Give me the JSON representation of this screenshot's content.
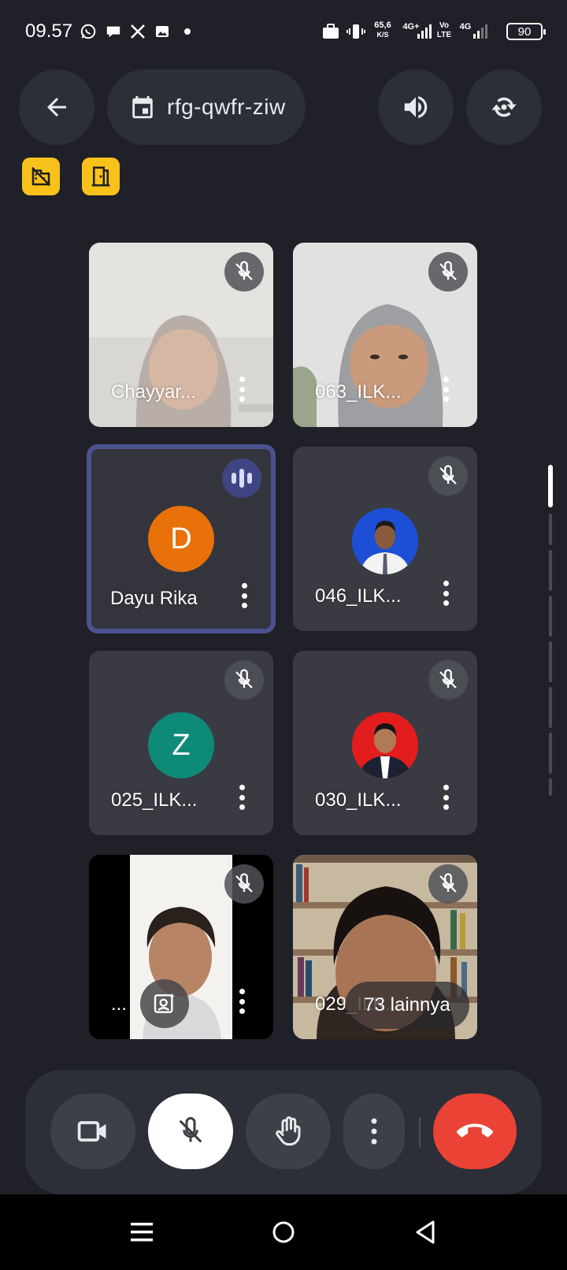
{
  "status_bar": {
    "time": "09.57",
    "network_speed": "65,6",
    "network_speed_unit": "K/S",
    "net_type_1": "4G+",
    "volte": "Vo LTE",
    "net_type_2": "4G",
    "battery": "90"
  },
  "top_bar": {
    "meeting_code": "rfg-qwfr-ziw"
  },
  "participants": [
    {
      "name": "Chayyar...",
      "kind": "video",
      "mic": "muted"
    },
    {
      "name": "063_ILK...",
      "kind": "video",
      "mic": "muted"
    },
    {
      "name": "Dayu Rika",
      "kind": "avatar",
      "initial": "D",
      "color": "#e8710a",
      "mic": "speaking"
    },
    {
      "name": "046_ILK...",
      "kind": "photo",
      "mic": "muted"
    },
    {
      "name": "025_ILK...",
      "kind": "avatar",
      "initial": "Z",
      "color": "#0e8a78",
      "mic": "muted"
    },
    {
      "name": "030_ILK...",
      "kind": "photo",
      "mic": "muted"
    },
    {
      "name": "...",
      "kind": "video",
      "mic": "muted"
    },
    {
      "name": "029_ILK...",
      "kind": "video",
      "mic": "muted"
    }
  ],
  "more_participants": "73 lainnya",
  "colors": {
    "background": "#1f2028",
    "surface": "#2c2e38",
    "end_call": "#ea4335",
    "chip_yellow": "#f9c21a",
    "active_border": "#4b5290"
  },
  "controls": {
    "camera": "camera-icon",
    "mic": "mic-off-icon",
    "raise_hand": "hand-icon",
    "more": "more-vert-icon",
    "end_call": "call-end-icon"
  }
}
